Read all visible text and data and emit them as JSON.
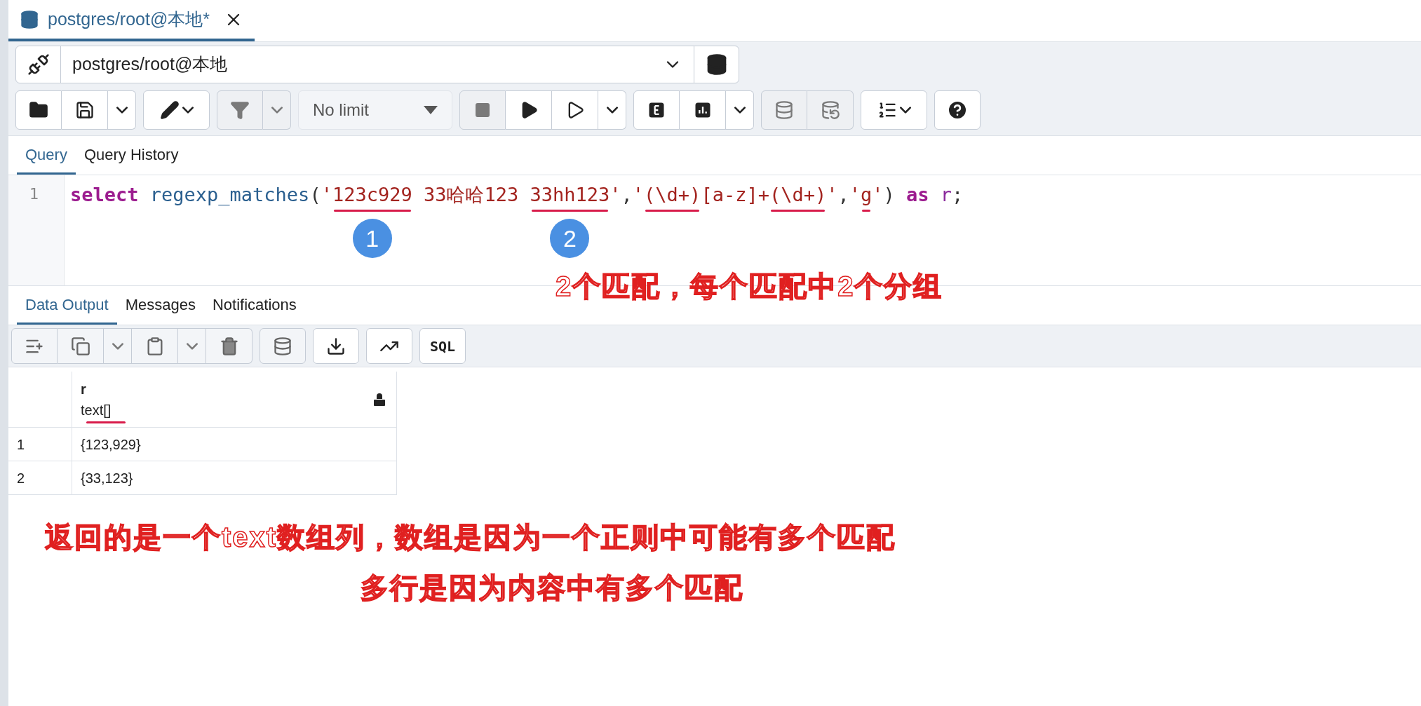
{
  "editor_tab": {
    "title": "postgres/root@本地*",
    "selected": true
  },
  "connection": {
    "value": "postgres/root@本地"
  },
  "toolbar": {
    "groups": [
      [
        {
          "kind": "open",
          "disabled": false
        },
        {
          "kind": "save",
          "disabled": false
        },
        {
          "kind": "caret",
          "disabled": false
        }
      ],
      [
        {
          "kind": "edit",
          "disabled": false
        }
      ],
      [
        {
          "kind": "filter",
          "disabled": true
        },
        {
          "kind": "caret",
          "disabled": true
        }
      ],
      [
        {
          "kind": "limit",
          "label": "No limit",
          "disabled": false
        }
      ],
      [
        {
          "kind": "stop",
          "disabled": true
        },
        {
          "kind": "run",
          "disabled": false
        },
        {
          "kind": "run-cursor",
          "disabled": false
        },
        {
          "kind": "caret",
          "disabled": false
        }
      ],
      [
        {
          "kind": "explain",
          "disabled": false
        },
        {
          "kind": "analyze",
          "disabled": false
        },
        {
          "kind": "caret",
          "disabled": false
        }
      ],
      [
        {
          "kind": "commit",
          "disabled": true
        },
        {
          "kind": "rollback",
          "disabled": true
        }
      ],
      [
        {
          "kind": "macros",
          "disabled": false
        }
      ],
      [
        {
          "kind": "help",
          "disabled": false
        }
      ]
    ]
  },
  "query_tabs": [
    {
      "label": "Query",
      "selected": true
    },
    {
      "label": "Query History",
      "selected": false
    }
  ],
  "editor": {
    "lines": [
      {
        "number": "1",
        "tokens": [
          {
            "kind": "keyword",
            "text": "select "
          },
          {
            "kind": "func",
            "text": "regexp_matches"
          },
          {
            "kind": "punct",
            "text": "("
          },
          {
            "kind": "string",
            "text": "'"
          },
          {
            "kind": "string",
            "text": "123c929",
            "marked": true,
            "badge": "1"
          },
          {
            "kind": "string",
            "text": " 33哈哈123 "
          },
          {
            "kind": "string",
            "text": "33hh123",
            "marked": true,
            "badge": "2"
          },
          {
            "kind": "string",
            "text": "'"
          },
          {
            "kind": "punct",
            "text": ","
          },
          {
            "kind": "string",
            "text": "'"
          },
          {
            "kind": "string",
            "text": "(\\d+)",
            "marked": true
          },
          {
            "kind": "string",
            "text": "[a-z]+"
          },
          {
            "kind": "string",
            "text": "(\\d+)",
            "marked": true
          },
          {
            "kind": "string",
            "text": "'"
          },
          {
            "kind": "punct",
            "text": ","
          },
          {
            "kind": "string",
            "text": "'"
          },
          {
            "kind": "string",
            "text": "g",
            "marked": true
          },
          {
            "kind": "string",
            "text": "'"
          },
          {
            "kind": "punct",
            "text": ") "
          },
          {
            "kind": "keyword",
            "text": "as "
          },
          {
            "kind": "ident",
            "text": "r"
          },
          {
            "kind": "punct",
            "text": ";"
          }
        ]
      }
    ]
  },
  "editor_note": "2个匹配，每个匹配中2个分组",
  "output_tabs": [
    {
      "label": "Data Output",
      "selected": true
    },
    {
      "label": "Messages",
      "selected": false
    },
    {
      "label": "Notifications",
      "selected": false
    }
  ],
  "data_toolbar": {
    "groups": [
      [
        {
          "kind": "add-row"
        },
        {
          "kind": "copy"
        },
        {
          "kind": "caret"
        },
        {
          "kind": "paste"
        },
        {
          "kind": "caret"
        },
        {
          "kind": "delete"
        }
      ],
      [
        {
          "kind": "save-data"
        }
      ],
      [
        {
          "kind": "download"
        }
      ],
      [
        {
          "kind": "graph"
        }
      ],
      [
        {
          "kind": "sql",
          "label": "SQL"
        }
      ]
    ]
  },
  "grid": {
    "columns": [
      {
        "name": "r",
        "type": "text[]",
        "type_marked": true,
        "locked": true
      }
    ],
    "rows": [
      {
        "number": "1",
        "cells": [
          "{123,929}"
        ]
      },
      {
        "number": "2",
        "cells": [
          "{33,123}"
        ]
      }
    ]
  },
  "result_notes": [
    "返回的是一个text数组列，数组是因为一个正则中可能有多个匹配",
    "多行是因为内容中有多个匹配"
  ]
}
